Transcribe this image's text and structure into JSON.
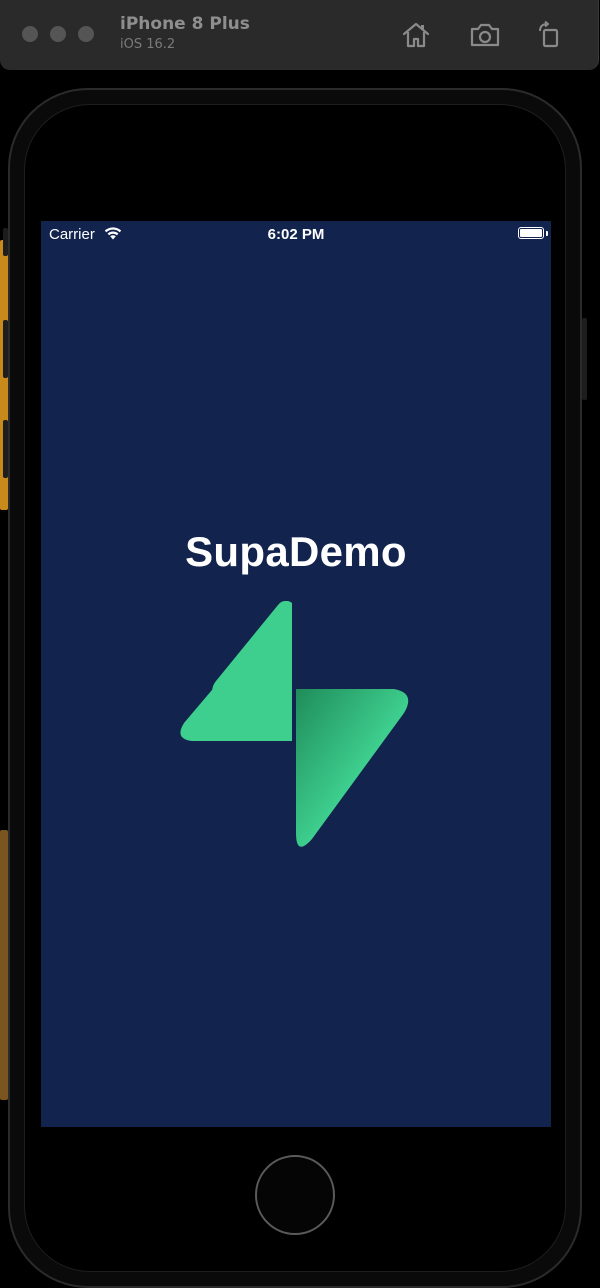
{
  "simulator": {
    "device_name": "iPhone 8 Plus",
    "os_version": "iOS 16.2"
  },
  "status_bar": {
    "carrier": "Carrier",
    "time": "6:02 PM"
  },
  "app": {
    "title": "SupaDemo",
    "background_color": "#12244d",
    "logo_color": "#3ecf8e",
    "logo_icon": "supabase-bolt-icon"
  }
}
